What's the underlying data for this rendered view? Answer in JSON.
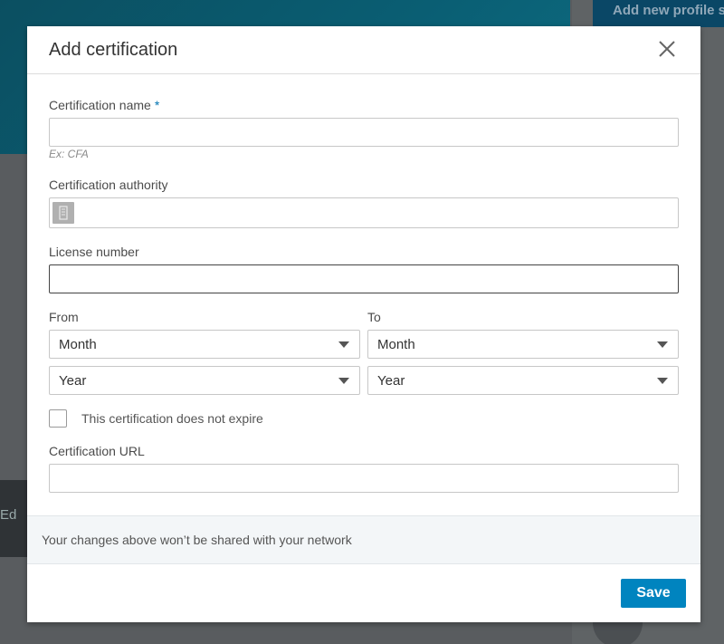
{
  "background": {
    "top_right_button": "Add new profile section",
    "left_panel_text": "Ed"
  },
  "modal": {
    "title": "Add certification",
    "close_icon": "close-icon",
    "fields": {
      "certification_name": {
        "label": "Certification name",
        "required_mark": "*",
        "value": "",
        "hint": "Ex: CFA"
      },
      "certification_authority": {
        "label": "Certification authority",
        "value": "",
        "icon": "company-icon"
      },
      "license_number": {
        "label": "License number",
        "value": ""
      },
      "from": {
        "label": "From",
        "month": "Month",
        "year": "Year"
      },
      "to": {
        "label": "To",
        "month": "Month",
        "year": "Year"
      },
      "no_expire": {
        "label": "This certification does not expire",
        "checked": false
      },
      "certification_url": {
        "label": "Certification URL",
        "value": ""
      }
    },
    "notice": "Your changes above won’t be shared with your network",
    "save_label": "Save"
  },
  "colors": {
    "accent": "#0084bf",
    "required": "#0073b1",
    "notice_bg": "#f3f6f8"
  }
}
